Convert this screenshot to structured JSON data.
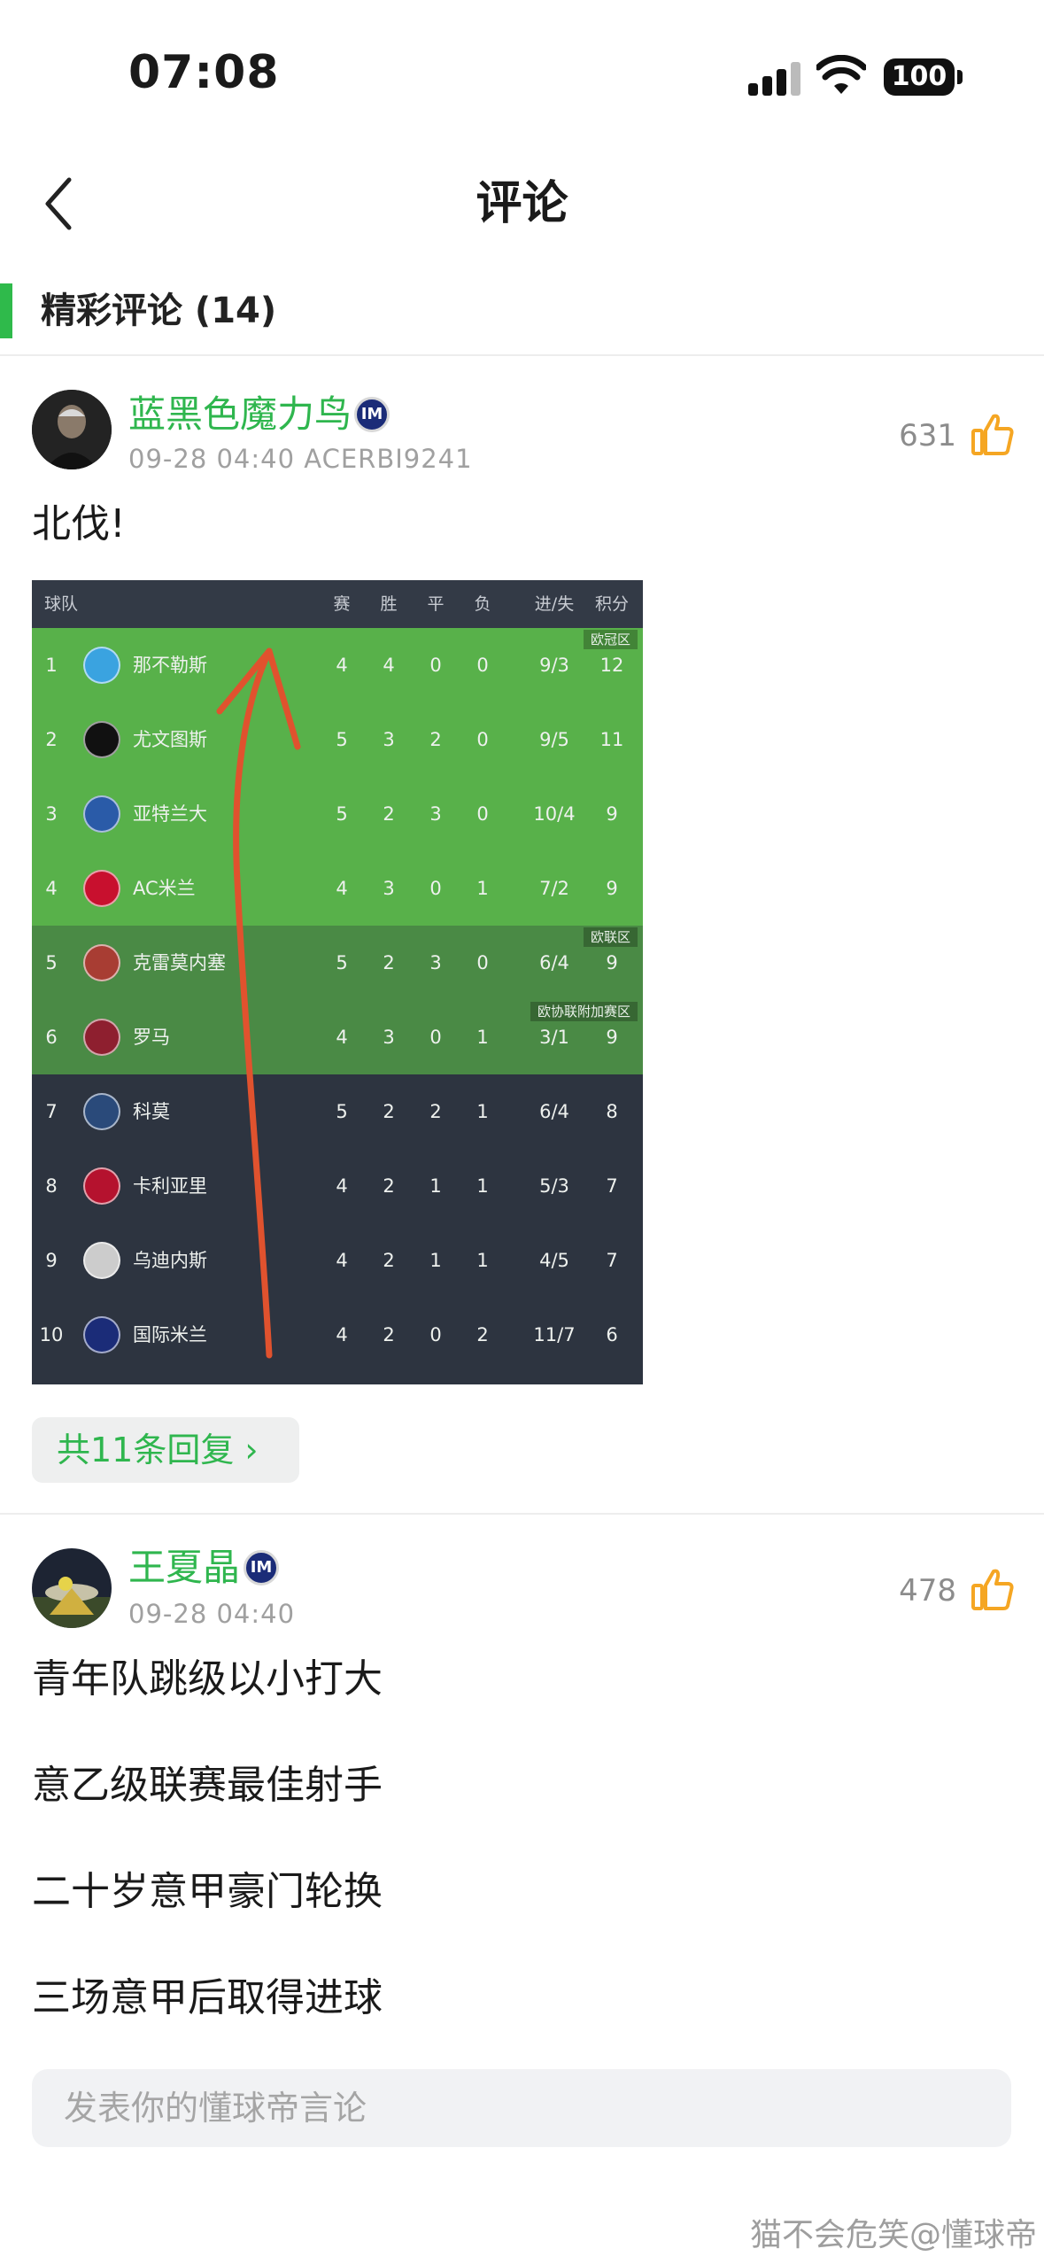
{
  "status_bar": {
    "time": "07:08",
    "battery": "100"
  },
  "header": {
    "title": "评论",
    "back_icon": "chevron-left-icon"
  },
  "section": {
    "title": "精彩评论 (14)",
    "accent_color": "#2fba4b"
  },
  "comments": [
    {
      "username": "蓝黑色魔力鸟",
      "meta": "09-28 04:40 ACERBI9241",
      "likes": "631",
      "text": [
        "北伐!"
      ],
      "reply_link": "共11条回复 ›"
    },
    {
      "username": "王夏晶",
      "meta": "09-28 04:40",
      "likes": "478",
      "text": [
        "青年队跳级以小打大",
        "意乙级联赛最佳射手",
        "二十岁意甲豪门轮换",
        "三场意甲后取得进球"
      ]
    }
  ],
  "standings": {
    "headers": [
      "球队",
      "赛",
      "胜",
      "平",
      "负",
      "进/失",
      "积分"
    ],
    "zones": [
      "欧冠区",
      "欧联区",
      "欧协联附加赛区"
    ],
    "rows": [
      {
        "rank": "1",
        "team": "那不勒斯",
        "p": "4",
        "w": "4",
        "d": "0",
        "l": "0",
        "gd": "9/3",
        "pts": "12"
      },
      {
        "rank": "2",
        "team": "尤文图斯",
        "p": "5",
        "w": "3",
        "d": "2",
        "l": "0",
        "gd": "9/5",
        "pts": "11"
      },
      {
        "rank": "3",
        "team": "亚特兰大",
        "p": "5",
        "w": "2",
        "d": "3",
        "l": "0",
        "gd": "10/4",
        "pts": "9"
      },
      {
        "rank": "4",
        "team": "AC米兰",
        "p": "4",
        "w": "3",
        "d": "0",
        "l": "1",
        "gd": "7/2",
        "pts": "9"
      },
      {
        "rank": "5",
        "team": "克雷莫内塞",
        "p": "5",
        "w": "2",
        "d": "3",
        "l": "0",
        "gd": "6/4",
        "pts": "9"
      },
      {
        "rank": "6",
        "team": "罗马",
        "p": "4",
        "w": "3",
        "d": "0",
        "l": "1",
        "gd": "3/1",
        "pts": "9"
      },
      {
        "rank": "7",
        "team": "科莫",
        "p": "5",
        "w": "2",
        "d": "2",
        "l": "1",
        "gd": "6/4",
        "pts": "8"
      },
      {
        "rank": "8",
        "team": "卡利亚里",
        "p": "4",
        "w": "2",
        "d": "1",
        "l": "1",
        "gd": "5/3",
        "pts": "7"
      },
      {
        "rank": "9",
        "team": "乌迪内斯",
        "p": "4",
        "w": "2",
        "d": "1",
        "l": "1",
        "gd": "4/5",
        "pts": "7"
      },
      {
        "rank": "10",
        "team": "国际米兰",
        "p": "4",
        "w": "2",
        "d": "0",
        "l": "2",
        "gd": "11/7",
        "pts": "6"
      }
    ],
    "colors": {
      "ucl": "#58b14a",
      "uel": "#4a8a45",
      "rest": "#2d3440",
      "arrow": "#e0522e"
    }
  },
  "input": {
    "placeholder": "发表你的懂球帝言论"
  },
  "watermark": "猫不会危笑@懂球帝"
}
